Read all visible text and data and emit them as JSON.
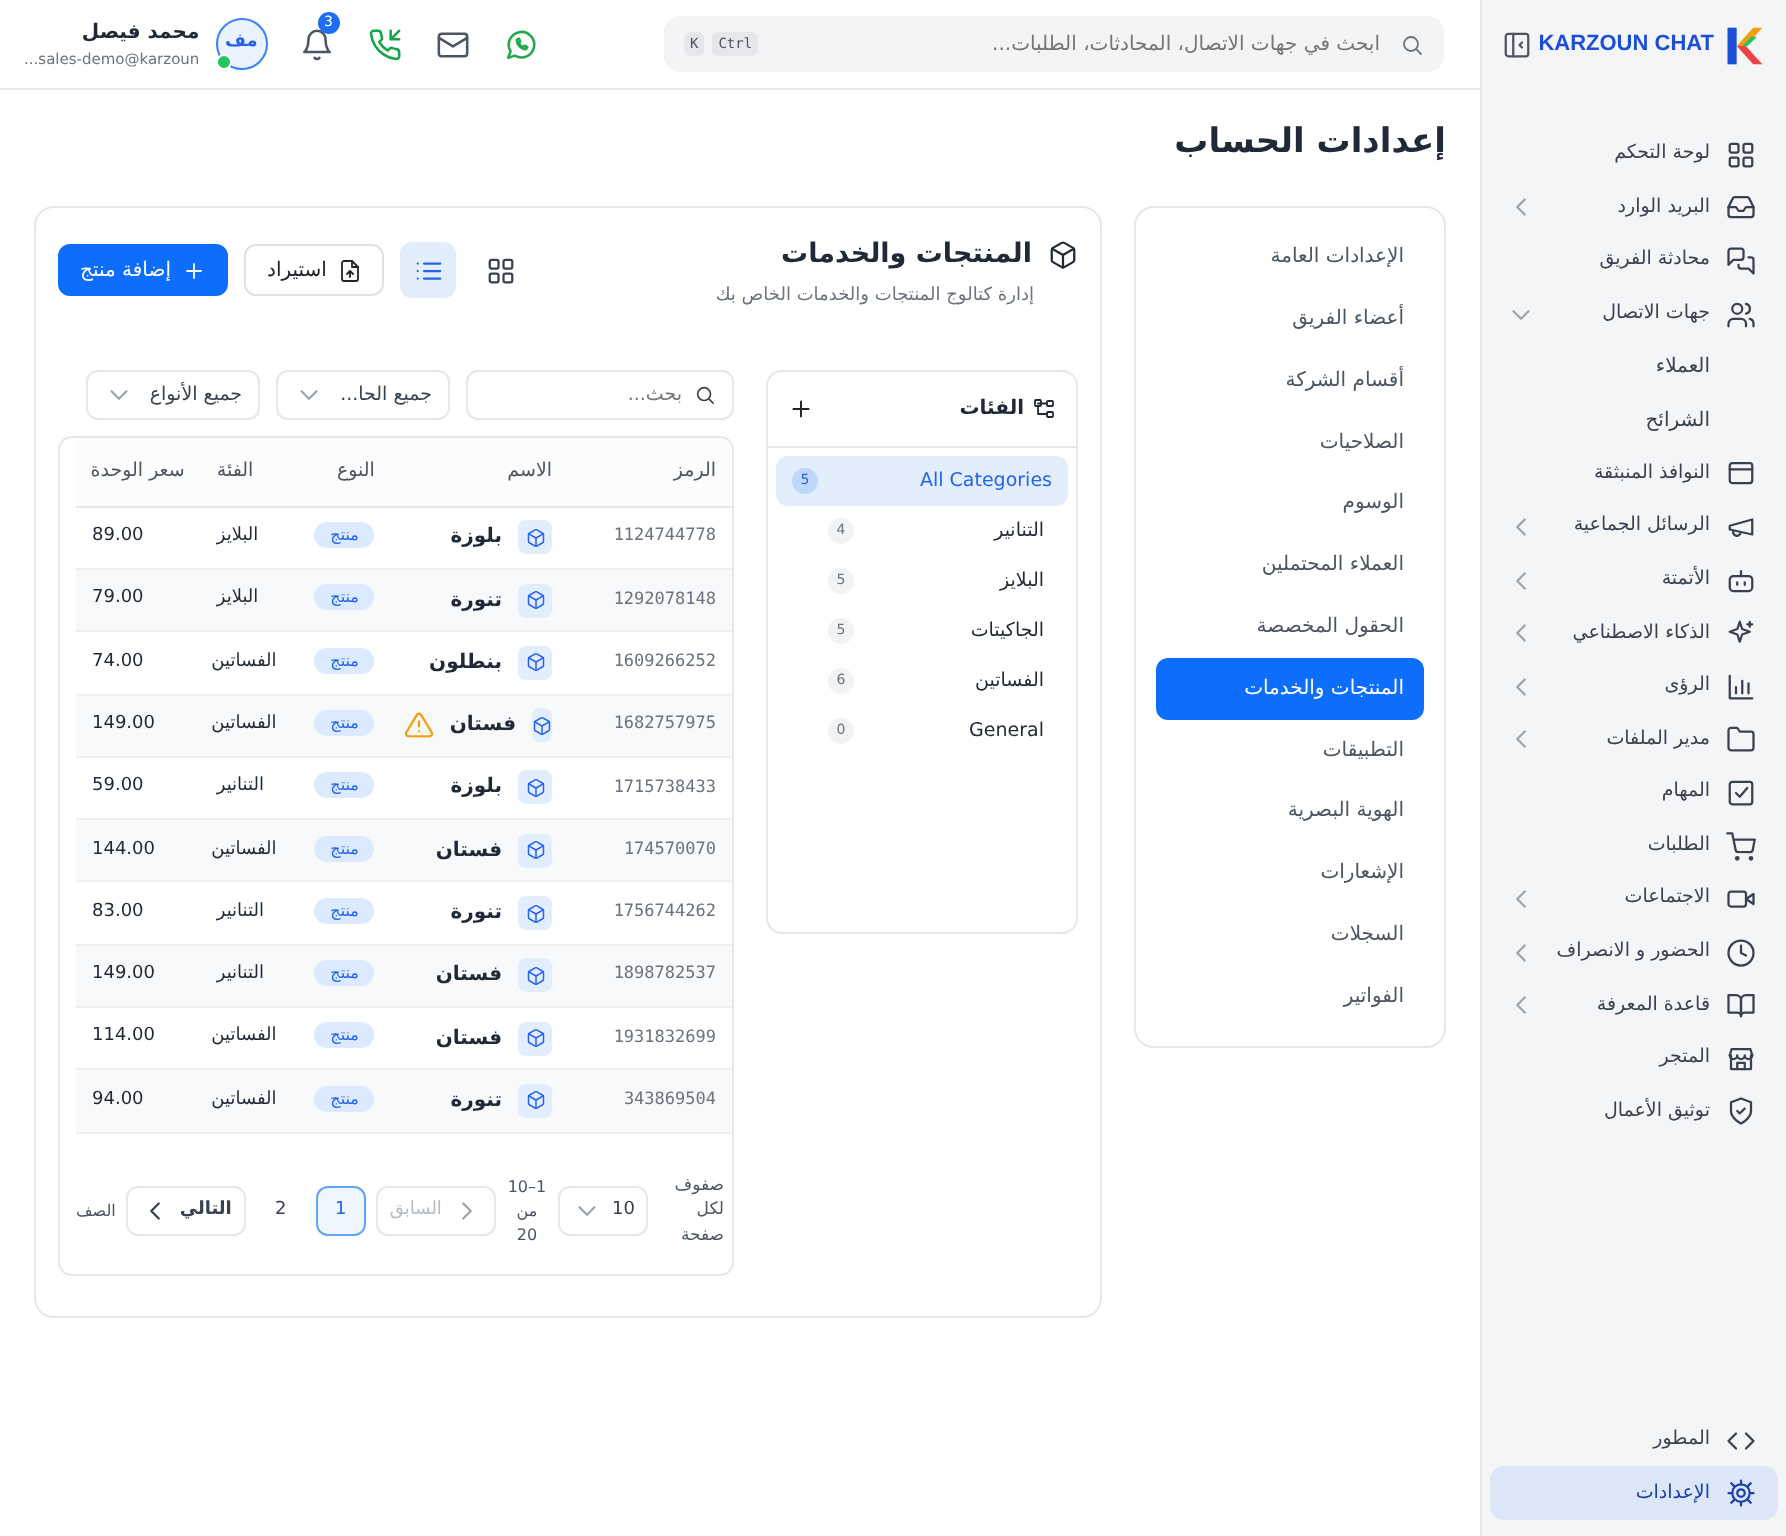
{
  "sidebar": {
    "brand": "KARZOUN CHAT",
    "items": [
      {
        "kind": "link",
        "label": "لوحة التحكم",
        "selected": false
      },
      {
        "kind": "group",
        "label": "البريد الوارد",
        "expanded": false,
        "selected": false
      },
      {
        "kind": "link",
        "label": "محادثة الفريق",
        "selected": false
      },
      {
        "kind": "group",
        "label": "جهات الاتصال",
        "expanded": true,
        "selected": false,
        "children": [
          {
            "label": "العملاء",
            "selected": false
          },
          {
            "label": "الشرائح",
            "selected": false
          }
        ]
      },
      {
        "kind": "link",
        "label": "النوافذ المنبثقة",
        "selected": false
      },
      {
        "kind": "group",
        "label": "الرسائل الجماعية",
        "expanded": false,
        "selected": false
      },
      {
        "kind": "group",
        "label": "الأتمتة",
        "expanded": false,
        "selected": false
      },
      {
        "kind": "group",
        "label": "الذكاء الاصطناعي",
        "expanded": false,
        "selected": false
      },
      {
        "kind": "group",
        "label": "الرؤى",
        "expanded": false,
        "selected": false
      },
      {
        "kind": "group",
        "label": "مدير الملفات",
        "expanded": false,
        "selected": false
      },
      {
        "kind": "link",
        "label": "المهام",
        "selected": false
      },
      {
        "kind": "link",
        "label": "الطلبات",
        "selected": false
      },
      {
        "kind": "group",
        "label": "الاجتماعات",
        "expanded": false,
        "selected": false
      },
      {
        "kind": "group",
        "label": "الحضور و الانصراف",
        "expanded": false,
        "selected": false
      },
      {
        "kind": "group",
        "label": "قاعدة المعرفة",
        "expanded": false,
        "selected": false
      },
      {
        "kind": "link",
        "label": "المتجر",
        "selected": false
      },
      {
        "kind": "link",
        "label": "توثيق الأعمال",
        "selected": false
      }
    ],
    "footer_items": [
      {
        "label": "المطور",
        "selected": false
      },
      {
        "label": "الإعدادات",
        "selected": true
      }
    ]
  },
  "topbar": {
    "search": {
      "placeholder": "ابحث في جهات الاتصال، المحادثات، الطلبات...",
      "shortcut_keys": [
        "Ctrl",
        "K"
      ]
    },
    "notifications": "3",
    "user": {
      "initials": "مف",
      "name": "محمد فيصل",
      "email": "sales-demo@karzoun...",
      "online": true
    }
  },
  "page_title": "إعدادات الحساب",
  "settings_menu": [
    {
      "label": "الإعدادات العامة",
      "selected": false
    },
    {
      "label": "أعضاء الفريق",
      "selected": false
    },
    {
      "label": "أقسام الشركة",
      "selected": false
    },
    {
      "label": "الصلاحيات",
      "selected": false
    },
    {
      "label": "الوسوم",
      "selected": false
    },
    {
      "label": "العملاء المحتملين",
      "selected": false
    },
    {
      "label": "الحقول المخصصة",
      "selected": false
    },
    {
      "label": "المنتجات والخدمات",
      "selected": true
    },
    {
      "label": "التطبيقات",
      "selected": false
    },
    {
      "label": "الهوية البصرية",
      "selected": false
    },
    {
      "label": "الإشعارات",
      "selected": false
    },
    {
      "label": "السجلات",
      "selected": false
    },
    {
      "label": "الفواتير",
      "selected": false
    }
  ],
  "products": {
    "title": "المنتجات والخدمات",
    "subtitle": "إدارة كتالوج المنتجات والخدمات الخاص بك",
    "view_toggles": [
      {
        "kind": "grid",
        "selected": false
      },
      {
        "kind": "list",
        "selected": true
      }
    ],
    "import_button": "استيراد",
    "add_button": "إضافة منتج",
    "categories": {
      "title": "الفئات",
      "all": {
        "label": "All Categories",
        "count": "5",
        "selected": true
      },
      "items": [
        {
          "label": "التنانير",
          "count": "4",
          "selected": false
        },
        {
          "label": "البلايز",
          "count": "5",
          "selected": false
        },
        {
          "label": "الجاكيتات",
          "count": "5",
          "selected": false
        },
        {
          "label": "الفساتين",
          "count": "6",
          "selected": false
        },
        {
          "label": "General",
          "count": "0",
          "selected": false
        }
      ]
    },
    "filters": {
      "search_placeholder": "بحث...",
      "status": "جميع الحا...",
      "type": "جميع الأنواع"
    },
    "table": {
      "columns": [
        "الرمز",
        "الاسم",
        "النوع",
        "الفئة",
        "سعر الوحدة"
      ],
      "rows": [
        {
          "code": "1124744778",
          "name": "بلوزة",
          "warning": false,
          "type": "منتج",
          "category": "البلايز",
          "price": "89.00"
        },
        {
          "code": "1292078148",
          "name": "تنورة",
          "warning": false,
          "type": "منتج",
          "category": "البلايز",
          "price": "79.00"
        },
        {
          "code": "1609266252",
          "name": "بنطلون",
          "warning": false,
          "type": "منتج",
          "category": "الفساتين",
          "price": "74.00"
        },
        {
          "code": "1682757975",
          "name": "فستان",
          "warning": true,
          "type": "منتج",
          "category": "الفساتين",
          "price": "149.00"
        },
        {
          "code": "1715738433",
          "name": "بلوزة",
          "warning": false,
          "type": "منتج",
          "category": "التنانير",
          "price": "59.00"
        },
        {
          "code": "174570070",
          "name": "فستان",
          "warning": false,
          "type": "منتج",
          "category": "الفساتين",
          "price": "144.00"
        },
        {
          "code": "1756744262",
          "name": "تنورة",
          "warning": false,
          "type": "منتج",
          "category": "التنانير",
          "price": "83.00"
        },
        {
          "code": "1898782537",
          "name": "فستان",
          "warning": false,
          "type": "منتج",
          "category": "التنانير",
          "price": "149.00"
        },
        {
          "code": "1931832699",
          "name": "فستان",
          "warning": false,
          "type": "منتج",
          "category": "الفساتين",
          "price": "114.00"
        },
        {
          "code": "343869504",
          "name": "تنورة",
          "warning": false,
          "type": "منتج",
          "category": "الفساتين",
          "price": "94.00"
        }
      ]
    },
    "pagination": {
      "rows_per_page_label": "صفوف لكل صفحة",
      "rows_per_page": "10",
      "range": "1–10 من 20",
      "previous": {
        "label": "السابق",
        "disabled": true
      },
      "pages": [
        {
          "label": "1",
          "selected": true
        },
        {
          "label": "2",
          "selected": false
        }
      ],
      "next": {
        "label": "التالي",
        "disabled": false
      },
      "page_label": "الصف"
    }
  }
}
